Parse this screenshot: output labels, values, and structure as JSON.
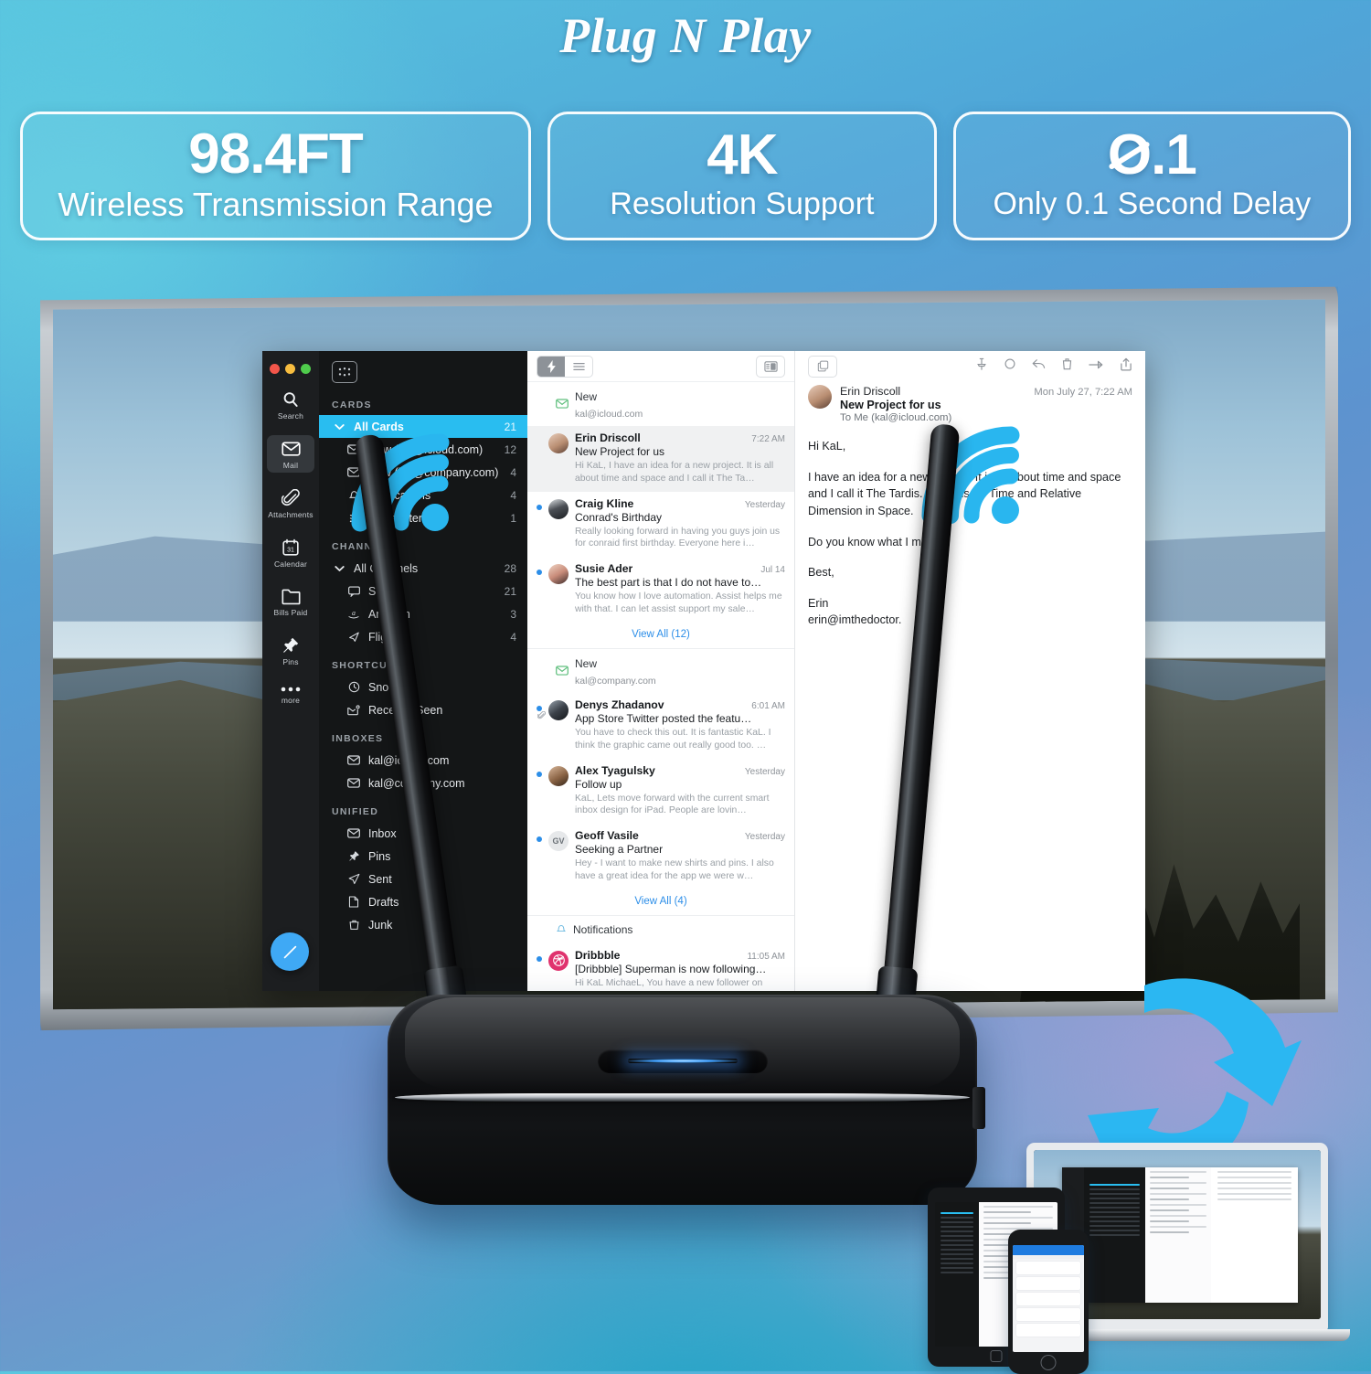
{
  "header": {
    "title": "Plug N Play",
    "badges": [
      {
        "id": "range",
        "value": "98.4FT",
        "caption": "Wireless Transmission Range"
      },
      {
        "id": "resolution",
        "value": "4K",
        "caption": "Resolution Support"
      },
      {
        "id": "delay",
        "value": "0.1",
        "value_prefix": "Ø",
        "value_suffix": ".1",
        "caption": "Only 0.1 Second Delay"
      }
    ]
  },
  "mail_app": {
    "window_controls": [
      "close",
      "minimize",
      "zoom"
    ],
    "rail": [
      {
        "icon": "search-icon",
        "label": "Search",
        "active": false
      },
      {
        "icon": "mail-icon",
        "label": "Mail",
        "active": true
      },
      {
        "icon": "attachment-icon",
        "label": "Attachments",
        "active": false
      },
      {
        "icon": "calendar-icon",
        "label": "Calendar",
        "active": false
      },
      {
        "icon": "folder-icon",
        "label": "Bills Paid",
        "active": false
      },
      {
        "icon": "pin-icon",
        "label": "Pins",
        "active": false
      },
      {
        "icon": "more-icon",
        "label": "more",
        "active": false
      }
    ],
    "compose_button": "compose-icon",
    "sidebar": {
      "sections": [
        {
          "title": "CARDS",
          "items": [
            {
              "label": "All Cards",
              "count": "21",
              "icon": "chevron-down-icon",
              "selected": true,
              "indent": false
            },
            {
              "label": "New (kal@icloud.com)",
              "count": "12",
              "icon": "envelope-icon",
              "selected": false,
              "indent": true
            },
            {
              "label": "New (kal@company.com)",
              "count": "4",
              "icon": "envelope-icon",
              "selected": false,
              "indent": true
            },
            {
              "label": "Notifications",
              "count": "4",
              "icon": "bell-icon",
              "selected": false,
              "indent": true
            },
            {
              "label": "Newsletters",
              "count": "1",
              "icon": "rss-icon",
              "selected": false,
              "indent": true
            }
          ]
        },
        {
          "title": "CHANNELS",
          "items": [
            {
              "label": "All Channels",
              "count": "28",
              "icon": "chevron-down-icon",
              "selected": false,
              "indent": false
            },
            {
              "label": "Social",
              "count": "21",
              "icon": "chat-icon",
              "selected": false,
              "indent": true
            },
            {
              "label": "Amazon",
              "count": "3",
              "icon": "amazon-icon",
              "selected": false,
              "indent": true
            },
            {
              "label": "Flights",
              "count": "4",
              "icon": "flight-icon",
              "selected": false,
              "indent": true
            }
          ]
        },
        {
          "title": "SHORTCUTS",
          "items": [
            {
              "label": "Snoozed",
              "count": "",
              "icon": "clock-icon",
              "selected": false,
              "indent": true
            },
            {
              "label": "Recently Seen",
              "count": "",
              "icon": "seen-mail-icon",
              "selected": false,
              "indent": true
            }
          ]
        },
        {
          "title": "INBOXES",
          "items": [
            {
              "label": "kal@icloud.com",
              "count": "",
              "icon": "envelope-icon",
              "selected": false,
              "indent": true
            },
            {
              "label": "kal@company.com",
              "count": "",
              "icon": "envelope-icon",
              "selected": false,
              "indent": true
            }
          ]
        },
        {
          "title": "UNIFIED",
          "items": [
            {
              "label": "Inbox",
              "count": "",
              "icon": "envelope-icon",
              "selected": false,
              "indent": true
            },
            {
              "label": "Pins",
              "count": "",
              "icon": "pin-icon",
              "selected": false,
              "indent": true
            },
            {
              "label": "Sent",
              "count": "",
              "icon": "send-icon",
              "selected": false,
              "indent": true
            },
            {
              "label": "Drafts",
              "count": "",
              "icon": "draft-icon",
              "selected": false,
              "indent": true
            },
            {
              "label": "Junk",
              "count": "",
              "icon": "junk-icon",
              "selected": false,
              "indent": true
            }
          ]
        }
      ]
    },
    "list_pane": {
      "toolbar": {
        "bolt": "bolt-icon",
        "list": "hamburger-icon",
        "layout": "split-view-icon"
      },
      "groups": [
        {
          "title": "New",
          "subtitle": "kal@icloud.com",
          "icon": "envelope-icon",
          "messages": [
            {
              "from": "Erin Driscoll",
              "time": "7:22 AM",
              "subject": "New Project for us",
              "preview": "Hi KaL, I have an idea for a new project. It is all about time and space and I call it The Ta…",
              "unread": false,
              "selected": true,
              "avatar": "ava",
              "initials": ""
            },
            {
              "from": "Craig Kline",
              "time": "Yesterday",
              "subject": "Conrad's Birthday",
              "preview": "Really looking forward in having you guys join us for conraid first birthday. Everyone here i…",
              "unread": true,
              "selected": false,
              "avatar": "avb",
              "initials": ""
            },
            {
              "from": "Susie Ader",
              "time": "Jul 14",
              "subject": "The best part is that I do not have to…",
              "preview": "You know how I love automation. Assist helps me with that. I can let assist support my sale…",
              "unread": true,
              "selected": false,
              "avatar": "avc",
              "initials": ""
            }
          ],
          "view_all": "View All (12)"
        },
        {
          "title": "New",
          "subtitle": "kal@company.com",
          "icon": "envelope-icon",
          "messages": [
            {
              "from": "Denys Zhadanov",
              "time": "6:01 AM",
              "subject": "App Store Twitter posted the featu…",
              "preview": "You have to check this out. It is fantastic KaL. I think the graphic came out really good too. …",
              "unread": true,
              "selected": false,
              "avatar": "avd",
              "initials": "",
              "attachment": true
            },
            {
              "from": "Alex Tyagulsky",
              "time": "Yesterday",
              "subject": "Follow up",
              "preview": "KaL, Lets move forward with the current smart inbox design for iPad. People are lovin…",
              "unread": true,
              "selected": false,
              "avatar": "ave",
              "initials": ""
            },
            {
              "from": "Geoff Vasile",
              "time": "Yesterday",
              "subject": "Seeking a Partner",
              "preview": "Hey - I want to make new shirts and pins. I also have a great idea for the app we were w…",
              "unread": true,
              "selected": false,
              "avatar": "avf",
              "initials": "GV"
            }
          ],
          "view_all": "View All (4)"
        },
        {
          "title": "Notifications",
          "subtitle": "",
          "icon": "bell-icon",
          "messages": [
            {
              "from": "Dribbble",
              "time": "11:05 AM",
              "subject": "[Dribbble] Superman is now following…",
              "preview": "Hi KaL MichaeL, You have a new follower on Dribbble. Superman UX/UI powerhouse and…",
              "unread": true,
              "selected": false,
              "avatar": "avg",
              "initials": ""
            }
          ],
          "view_all": ""
        }
      ]
    },
    "reading_pane": {
      "copy_icon": "copy-icon",
      "tools": [
        "pin-icon",
        "snooze-icon",
        "reply-icon",
        "trash-icon",
        "forward-icon",
        "share-icon"
      ],
      "from": "Erin Driscoll",
      "subject": "New Project for us",
      "to": "To Me (kal@icloud.com)",
      "date": "Mon July 27, 7:22 AM",
      "body": [
        "Hi KaL,",
        "I have an idea for a new project. It is all about time and space and I call it The Tardis. It stands for Time and Relative Dimension in Space.",
        "Do you know what I mean?",
        "Best,",
        "Erin\nerin@imthedoctor."
      ]
    }
  },
  "device": {
    "name": "wireless-hdmi-transmitter",
    "antennas": 2,
    "led_indicator": "blue-status-led",
    "wifi_marks": [
      "wifi-signal-left",
      "wifi-signal-right"
    ]
  },
  "sync": {
    "icon": "circular-sync-arrows"
  },
  "colors": {
    "accent_blue": "#29bdf0",
    "wifi_blue": "#29b6ef",
    "arrow_blue": "#2bb7f2",
    "link_blue": "#2c8ee8",
    "badge_border": "#ffffff",
    "dribbble_pink": "#e0336e"
  },
  "devices_preview": {
    "items": [
      {
        "name": "tablet",
        "label": "tablet-device"
      },
      {
        "name": "phone",
        "label": "phone-device"
      },
      {
        "name": "laptop",
        "label": "laptop-device"
      }
    ]
  }
}
